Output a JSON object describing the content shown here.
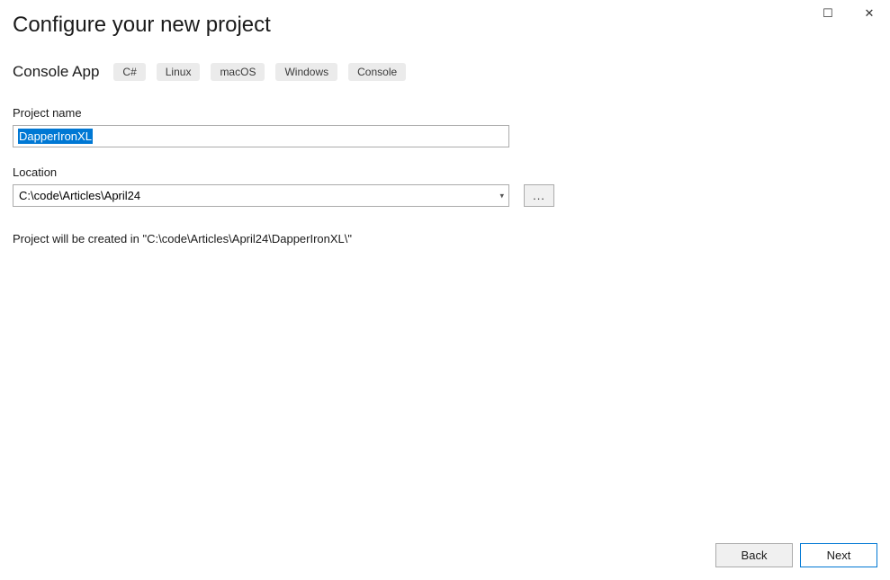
{
  "titleBar": {
    "maximize": "☐",
    "close": "✕"
  },
  "header": {
    "title": "Configure your new project"
  },
  "template": {
    "name": "Console App",
    "tags": [
      "C#",
      "Linux",
      "macOS",
      "Windows",
      "Console"
    ]
  },
  "fields": {
    "projectName": {
      "label": "Project name",
      "value": "DapperIronXL"
    },
    "location": {
      "label": "Location",
      "value": "C:\\code\\Articles\\April24",
      "browseLabel": "..."
    }
  },
  "info": {
    "createdInText": "Project will be created in \"C:\\code\\Articles\\April24\\DapperIronXL\\\""
  },
  "footer": {
    "backLabel": "Back",
    "nextLabel": "Next"
  }
}
